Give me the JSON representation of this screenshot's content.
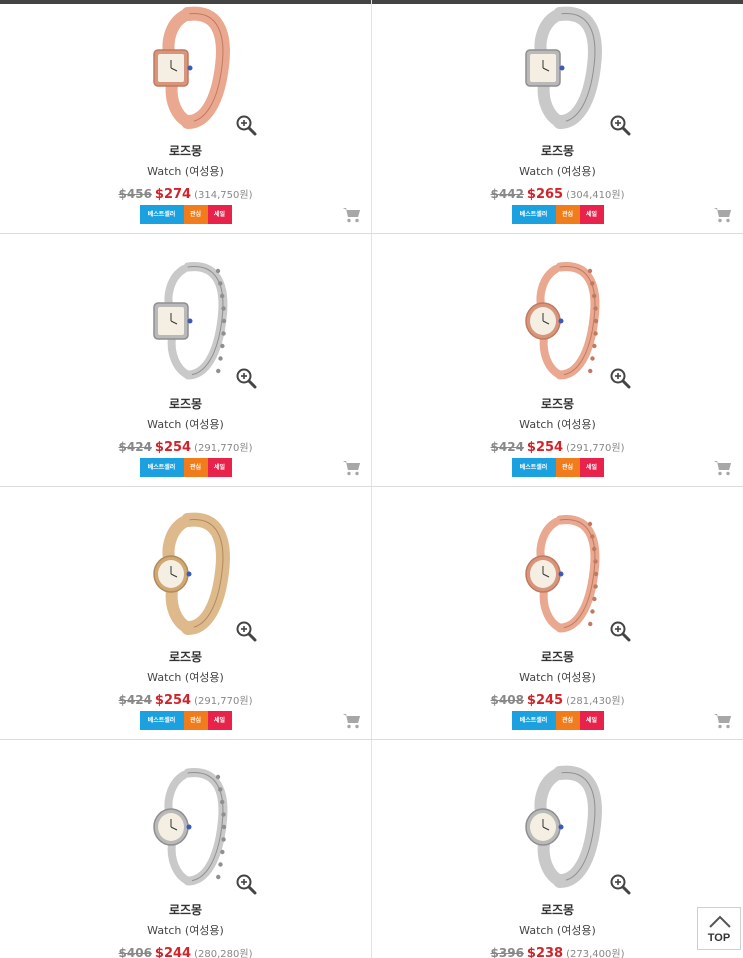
{
  "products": [
    {
      "brand": "로즈몽",
      "type": "Watch (여성용)",
      "orig": "$456",
      "sale": "$274",
      "krw": "(314,750원)",
      "metal": "rose",
      "style": "mesh-square",
      "badges": [
        "베스트셀러",
        "관심",
        "세일"
      ]
    },
    {
      "brand": "로즈몽",
      "type": "Watch (여성용)",
      "orig": "$442",
      "sale": "$265",
      "krw": "(304,410원)",
      "metal": "silver",
      "style": "mesh-square",
      "badges": [
        "베스트셀러",
        "관심",
        "세일"
      ]
    },
    {
      "brand": "로즈몽",
      "type": "Watch (여성용)",
      "orig": "$424",
      "sale": "$254",
      "krw": "(291,770원)",
      "metal": "silver",
      "style": "chain-square",
      "badges": [
        "베스트셀러",
        "관심",
        "세일"
      ]
    },
    {
      "brand": "로즈몽",
      "type": "Watch (여성용)",
      "orig": "$424",
      "sale": "$254",
      "krw": "(291,770원)",
      "metal": "rose",
      "style": "link-round",
      "badges": [
        "베스트셀러",
        "관심",
        "세일"
      ]
    },
    {
      "brand": "로즈몽",
      "type": "Watch (여성용)",
      "orig": "$424",
      "sale": "$254",
      "krw": "(291,770원)",
      "metal": "gold",
      "style": "mesh-round",
      "badges": [
        "베스트셀러",
        "관심",
        "세일"
      ]
    },
    {
      "brand": "로즈몽",
      "type": "Watch (여성용)",
      "orig": "$408",
      "sale": "$245",
      "krw": "(281,430원)",
      "metal": "rose",
      "style": "link-round",
      "badges": [
        "베스트셀러",
        "관심",
        "세일"
      ]
    },
    {
      "brand": "로즈몽",
      "type": "Watch (여성용)",
      "orig": "$406",
      "sale": "$244",
      "krw": "(280,280원)",
      "metal": "silver",
      "style": "link-round",
      "badges": [
        "베스트셀러",
        "관심",
        "세일"
      ]
    },
    {
      "brand": "로즈몽",
      "type": "Watch (여성용)",
      "orig": "$396",
      "sale": "$238",
      "krw": "(273,400원)",
      "metal": "silver",
      "style": "mesh-round",
      "badges": [
        "베스트셀러",
        "관심",
        "세일"
      ]
    }
  ],
  "top_button": {
    "label": "TOP"
  },
  "icons": {
    "zoom": "zoom-in-icon",
    "cart": "cart-icon",
    "top": "chevron-up-icon"
  },
  "colors": {
    "sale_price": "#d2232a",
    "badge_best": "#1ba0e0",
    "badge_interest": "#f07c1b",
    "badge_sale": "#e8224b"
  }
}
